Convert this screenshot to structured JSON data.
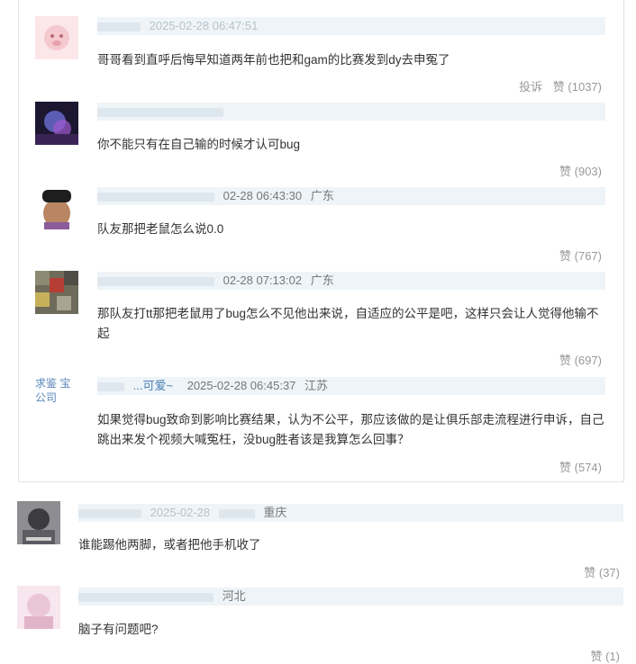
{
  "nested": [
    {
      "user": "",
      "date": "2025-02-28 06:47:51",
      "location": "",
      "content": "哥哥看到直呼后悔早知道两年前也把和gam的比赛发到dy去申冤了",
      "report": "投诉",
      "likes": "赞 (1037)"
    },
    {
      "user": "",
      "date": "",
      "location": "",
      "content": "你不能只有在自己输的时候才认可bug",
      "likes": "赞 (903)"
    },
    {
      "user": "",
      "date": "02-28 06:43:30",
      "location": "广东",
      "content": "队友那把老鼠怎么说0.0",
      "likes": "赞 (767)"
    },
    {
      "user": "",
      "date": "02-28 07:13:02",
      "location": "广东",
      "content": "那队友打tt那把老鼠用了bug怎么不见他出来说，自适应的公平是吧，这样只会让人觉得他输不起",
      "likes": "赞 (697)"
    },
    {
      "user": "...可爱~",
      "date": "2025-02-28 06:45:37",
      "location": "江苏",
      "avatar_alt": "求鉴 宝公司",
      "content": "如果觉得bug致命到影响比赛结果，认为不公平，那应该做的是让俱乐部走流程进行申诉，自己跳出来发个视频大喊冤枉，没bug胜者该是我算怎么回事？",
      "likes": "赞 (574)"
    }
  ],
  "top": [
    {
      "user": "",
      "date": "2025-02-28",
      "location": "重庆",
      "content": "谁能踢他两脚，或者把他手机收了",
      "likes": "赞 (37)"
    },
    {
      "user": "",
      "date": "",
      "location": "河北",
      "content": "脑子有问题吧?",
      "likes": "赞 (1)"
    }
  ]
}
